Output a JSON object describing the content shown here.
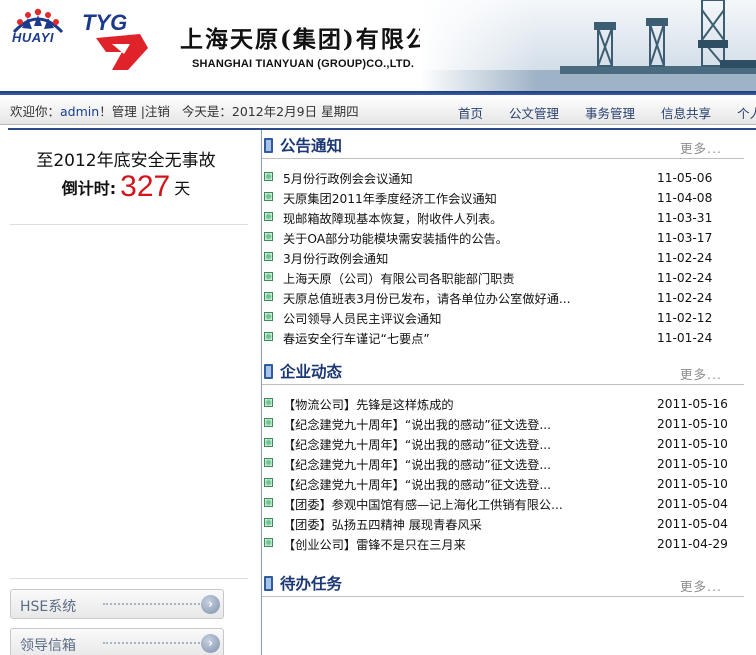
{
  "header": {
    "huayi_logo_text": "HUAYI",
    "tyg_logo_text": "TYG",
    "company_name_cn": "上海天原(集团)有限公司",
    "company_name_en": "SHANGHAI TIANYUAN (GROUP)CO.,LTD."
  },
  "navbar": {
    "welcome_prefix": "欢迎你：",
    "username": "admin",
    "exclaim": "！",
    "manage": "管理",
    "sep": "|",
    "logout": "注销",
    "today_label": "今天是：",
    "today": "2012年2月9日",
    "weekday": "星期四",
    "menu": [
      "首页",
      "公文管理",
      "事务管理",
      "信息共享",
      "个人"
    ]
  },
  "safety": {
    "title": "至2012年底安全无事故",
    "countdown_label": "倒计时:",
    "days": "327",
    "unit": "天"
  },
  "side_buttons": [
    {
      "label": "HSE系统"
    },
    {
      "label": "领导信箱"
    }
  ],
  "announcements": {
    "title": "公告通知",
    "more": "更多...",
    "items": [
      {
        "title": "5月份行政例会会议通知",
        "date": "11-05-06"
      },
      {
        "title": "天原集团2011年季度经济工作会议通知",
        "date": "11-04-08"
      },
      {
        "title": "现邮箱故障现基本恢复，附收件人列表。",
        "date": "11-03-31"
      },
      {
        "title": "关于OA部分功能模块需安装插件的公告。",
        "date": "11-03-17"
      },
      {
        "title": "3月份行政例会通知",
        "date": "11-02-24"
      },
      {
        "title": "上海天原（公司）有限公司各职能部门职责",
        "date": "11-02-24"
      },
      {
        "title": "天原总值班表3月份已发布，请各单位办公室做好通...",
        "date": "11-02-24"
      },
      {
        "title": "公司领导人员民主评议会通知",
        "date": "11-02-12"
      },
      {
        "title": "春运安全行车谨记“七要点”",
        "date": "11-01-24"
      }
    ]
  },
  "news": {
    "title": "企业动态",
    "more": "更多...",
    "items": [
      {
        "title": "【物流公司】先锋是这样炼成的",
        "date": "2011-05-16"
      },
      {
        "title": "【纪念建党九十周年】“说出我的感动”征文选登...",
        "date": "2011-05-10"
      },
      {
        "title": "【纪念建党九十周年】“说出我的感动”征文选登...",
        "date": "2011-05-10"
      },
      {
        "title": "【纪念建党九十周年】“说出我的感动”征文选登...",
        "date": "2011-05-10"
      },
      {
        "title": "【纪念建党九十周年】“说出我的感动”征文选登...",
        "date": "2011-05-10"
      },
      {
        "title": "【团委】参观中国馆有感—记上海化工供销有限公...",
        "date": "2011-05-04"
      },
      {
        "title": "【团委】弘扬五四精神  展现青春风采",
        "date": "2011-05-04"
      },
      {
        "title": "【创业公司】雷锋不是只在三月来",
        "date": "2011-04-29"
      }
    ]
  },
  "todo": {
    "title": "待办任务",
    "more": "更多..."
  },
  "colors": {
    "nav_blue": "#1e3c7c",
    "countdown_red": "#d4141b",
    "section_title": "#1c3874"
  }
}
